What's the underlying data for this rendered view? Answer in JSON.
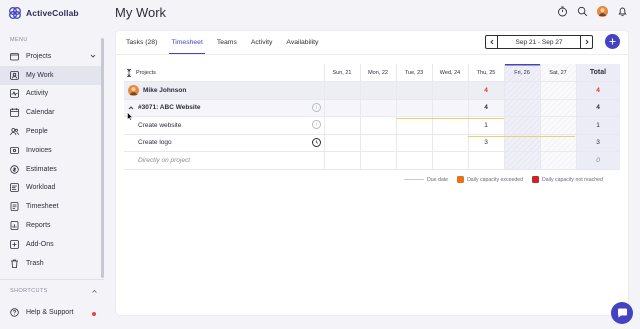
{
  "app": {
    "name": "ActiveCollab"
  },
  "sidebar": {
    "menu_heading": "MENU",
    "items": [
      {
        "label": "Projects",
        "icon": "folder-icon",
        "expandable": true
      },
      {
        "label": "My Work",
        "icon": "user-square-icon",
        "active": true
      },
      {
        "label": "Activity",
        "icon": "activity-icon"
      },
      {
        "label": "Calendar",
        "icon": "calendar-icon"
      },
      {
        "label": "People",
        "icon": "people-icon"
      },
      {
        "label": "Invoices",
        "icon": "invoice-icon"
      },
      {
        "label": "Estimates",
        "icon": "estimate-icon"
      },
      {
        "label": "Workload",
        "icon": "workload-icon"
      },
      {
        "label": "Timesheet",
        "icon": "timesheet-icon"
      },
      {
        "label": "Reports",
        "icon": "reports-icon"
      },
      {
        "label": "Add-Ons",
        "icon": "addons-icon"
      },
      {
        "label": "Trash",
        "icon": "trash-icon"
      }
    ],
    "shortcuts_heading": "SHORTCUTS",
    "help_label": "Help & Support"
  },
  "header": {
    "title": "My Work"
  },
  "tabs": [
    {
      "label": "Tasks (28)"
    },
    {
      "label": "Timesheet",
      "active": true
    },
    {
      "label": "Teams"
    },
    {
      "label": "Activity"
    },
    {
      "label": "Availability"
    }
  ],
  "week_nav": {
    "range": "Sep 21 - Sep 27"
  },
  "timesheet": {
    "projects_header": "Projects",
    "days": [
      "Sun, 21",
      "Mon, 22",
      "Tue, 23",
      "Wed, 24",
      "Thu, 25",
      "Fri, 26",
      "Sat, 27"
    ],
    "total_header": "Total",
    "rows": [
      {
        "kind": "person",
        "label": "Mike Johnson",
        "thu": "4",
        "total": "4"
      },
      {
        "kind": "project",
        "label": "#3071: ABC Website",
        "thu": "4",
        "total": "4"
      },
      {
        "kind": "task",
        "label": "Create website",
        "thu": "1",
        "total": "1"
      },
      {
        "kind": "task",
        "label": "Create logo",
        "thu": "3",
        "total": "3"
      },
      {
        "kind": "direct",
        "label": "Directly on project",
        "total": "0"
      }
    ]
  },
  "legend": {
    "due_date": "Due date",
    "exceeded": "Daily capacity exceeded",
    "not_reached": "Daily capacity not reached"
  },
  "colors": {
    "accent": "#4343c3",
    "exceeded": "#e8721c",
    "not_reached": "#c8242b",
    "red_value": "#e0302e",
    "due_line": "#e8d36b"
  }
}
